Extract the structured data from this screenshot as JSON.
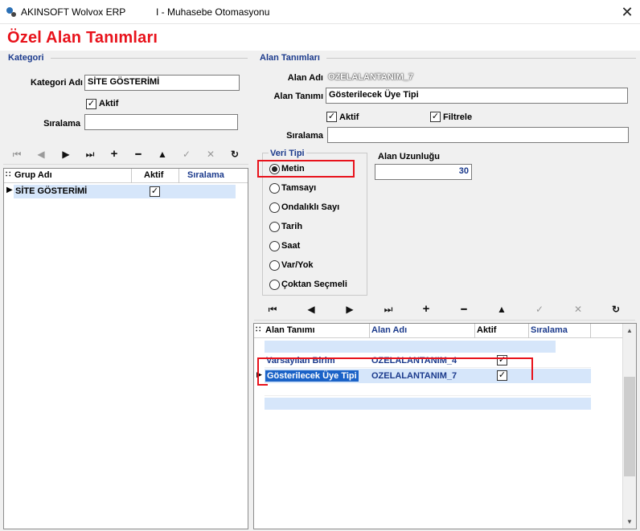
{
  "window": {
    "app_name": "AKINSOFT Wolvox ERP",
    "title": "I - Muhasebe Otomasyonu",
    "close_glyph": "✕"
  },
  "header": {
    "title": "Özel Alan Tanımları"
  },
  "kategori": {
    "section_label": "Kategori",
    "name_label": "Kategori Adı",
    "name_value": "SİTE GÖSTERİMİ",
    "aktif_label": "Aktif",
    "aktif_checked": true,
    "siralama_label": "Sıralama",
    "siralama_value": "",
    "grid": {
      "columns": [
        "Grup Adı",
        "Aktif",
        "Sıralama"
      ],
      "rows": [
        {
          "grup_adi": "SİTE GÖSTERİMİ",
          "aktif": true,
          "siralama": ""
        }
      ]
    }
  },
  "alan": {
    "section_label": "Alan Tanımları",
    "alan_adi_label": "Alan Adı",
    "alan_adi_value": "OZELALANTANIM_7",
    "alan_tanimi_label": "Alan Tanımı",
    "alan_tanimi_value": "Gösterilecek Üye Tipi",
    "aktif_label": "Aktif",
    "filtrele_label": "Filtrele",
    "siralama_label": "Sıralama",
    "siralama_value": "",
    "veri_tipi": {
      "label": "Veri Tipi",
      "options": [
        "Metin",
        "Tamsayı",
        "Ondalıklı Sayı",
        "Tarih",
        "Saat",
        "Var/Yok",
        "Çoktan Seçmeli"
      ],
      "selected": "Metin"
    },
    "uzunluk_label": "Alan Uzunluğu",
    "uzunluk_value": "30",
    "grid": {
      "columns": [
        "Alan Tanımı",
        "Alan Adı",
        "Aktif",
        "Sıralama"
      ],
      "rows": [
        {
          "alan_tanimi": "Varsayılan Birim",
          "alan_adi": "OZELALANTANIM_4",
          "aktif": true
        },
        {
          "alan_tanimi": "Gösterilecek Üye Tipi",
          "alan_adi": "OZELALANTANIM_7",
          "aktif": true
        }
      ]
    }
  },
  "icons": {
    "nav": [
      "first-icon",
      "prev-icon",
      "next-icon",
      "last-icon",
      "add-icon",
      "delete-icon",
      "up-icon",
      "confirm-icon",
      "cancel-icon",
      "refresh-icon"
    ],
    "glyphs": [
      "⏮",
      "◀",
      "▶",
      "⏭",
      "+",
      "━",
      "▲",
      "✓",
      "✕",
      "↻"
    ]
  },
  "colors": {
    "title_red": "#e8121b",
    "section_blue": "#1b3a8c",
    "selection": "#d6e6fa",
    "highlight_box": "#e8121b"
  }
}
